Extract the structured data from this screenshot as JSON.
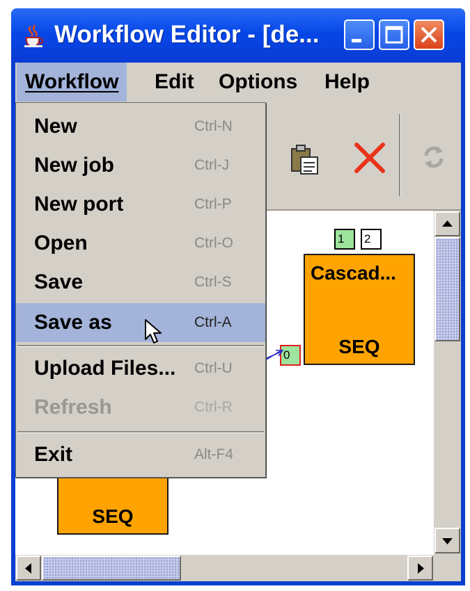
{
  "window": {
    "title": "Workflow Editor - [de...",
    "icons": [
      "java-cup-icon",
      "minimize-icon",
      "maximize-icon",
      "close-icon"
    ]
  },
  "menubar": {
    "items": [
      {
        "label": "Workflow",
        "active": true
      },
      {
        "label": "Edit"
      },
      {
        "label": "Options"
      },
      {
        "label": "Help"
      }
    ]
  },
  "dropdown": {
    "items": [
      {
        "label": "New",
        "shortcut": "Ctrl-N"
      },
      {
        "label": "New job",
        "shortcut": "Ctrl-J"
      },
      {
        "label": "New port",
        "shortcut": "Ctrl-P"
      },
      {
        "label": "Open",
        "shortcut": "Ctrl-O"
      },
      {
        "label": "Save",
        "shortcut": "Ctrl-S"
      },
      {
        "label": "Save as",
        "shortcut": "Ctrl-A",
        "highlighted": true
      },
      {
        "label": "Upload Files...",
        "shortcut": "Ctrl-U"
      },
      {
        "label": "Refresh",
        "shortcut": "Ctrl-R",
        "disabled": true
      },
      {
        "label": "Exit",
        "shortcut": "Alt-F4"
      }
    ]
  },
  "toolbar": {
    "icons": [
      "paste-icon",
      "delete-icon",
      "refresh-icon"
    ]
  },
  "canvas": {
    "job1": {
      "name": "Cascad...",
      "type": "SEQ",
      "ports_top": [
        "1",
        "2"
      ],
      "port_left": "0"
    },
    "job2": {
      "type": "SEQ"
    }
  },
  "colors": {
    "title_bar": "#0a4be0",
    "menu_highlight": "#a3b3d9",
    "job_fill": "#ffa300",
    "port_input": "#9ee39e",
    "port_output": "#ffffff",
    "port_error_border": "#e02020"
  }
}
